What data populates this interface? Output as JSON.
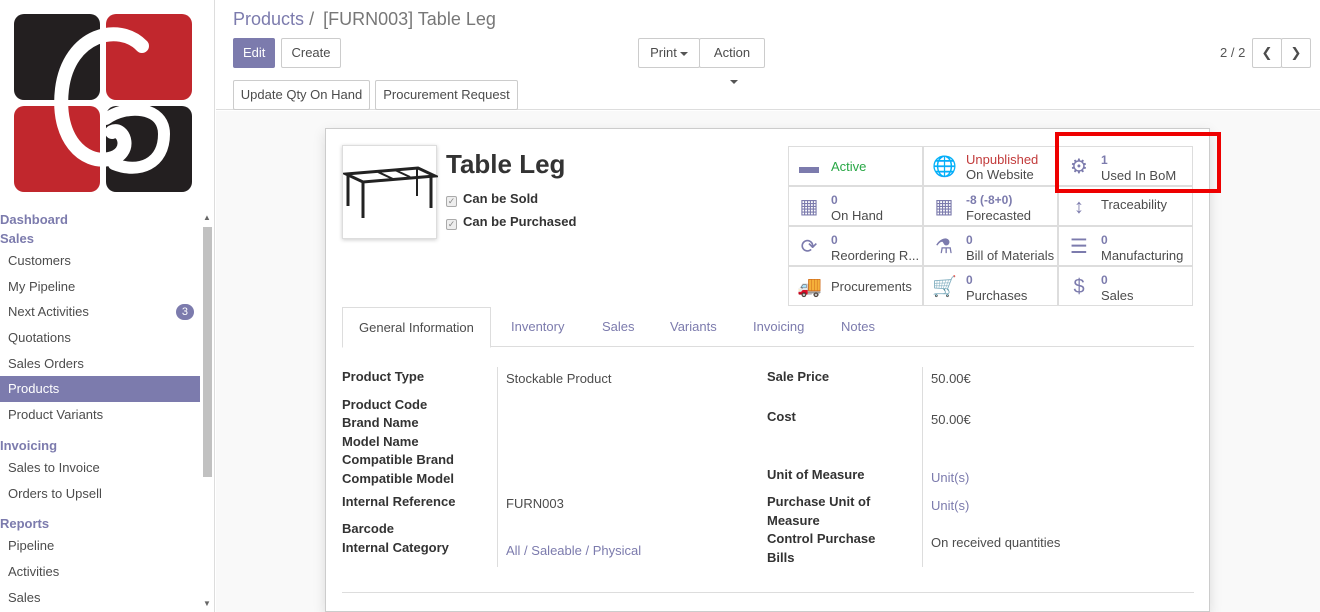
{
  "sidebar": {
    "sections": [
      {
        "title": "Dashboard"
      },
      {
        "title": "Sales",
        "items": [
          "Customers",
          "My Pipeline",
          "Next Activities",
          "Quotations",
          "Sales Orders",
          "Products",
          "Product Variants"
        ]
      },
      {
        "title": "Invoicing",
        "items": [
          "Sales to Invoice",
          "Orders to Upsell"
        ]
      },
      {
        "title": "Reports",
        "items": [
          "Pipeline",
          "Activities",
          "Sales"
        ]
      }
    ],
    "next_activities_badge": "3",
    "active_item": "Products"
  },
  "breadcrumb": {
    "parent": "Products",
    "separator": "/",
    "current": "[FURN003] Table Leg"
  },
  "buttons": {
    "edit": "Edit",
    "create": "Create",
    "print": "Print",
    "action": "Action",
    "update_qty": "Update Qty On Hand",
    "procurement_request": "Procurement Request"
  },
  "pager": {
    "value": "2 / 2"
  },
  "product": {
    "name": "Table Leg",
    "can_be_sold": "Can be Sold",
    "can_be_purchased": "Can be Purchased"
  },
  "smart_buttons": {
    "active": {
      "label": "Active",
      "color": "#28a745"
    },
    "website": {
      "line1": "Unpublished",
      "line2": "On Website",
      "color": "#c23b3b"
    },
    "bom": {
      "num": "1",
      "label": "Used In BoM"
    },
    "onhand": {
      "num": "0",
      "label": "On Hand"
    },
    "forecasted": {
      "num": "-8 (-8+0)",
      "label": "Forecasted"
    },
    "traceability": {
      "label": "Traceability"
    },
    "reordering": {
      "num": "0",
      "label": "Reordering R..."
    },
    "bom_materials": {
      "num": "0",
      "label": "Bill of Materials"
    },
    "manufacturing": {
      "num": "0",
      "label": "Manufacturing"
    },
    "procurements": {
      "label": "Procurements"
    },
    "purchases": {
      "num": "0",
      "label": "Purchases"
    },
    "sales": {
      "num": "0",
      "label": "Sales"
    }
  },
  "tabs": [
    "General Information",
    "Inventory",
    "Sales",
    "Variants",
    "Invoicing",
    "Notes"
  ],
  "fields": {
    "product_type": {
      "label": "Product Type",
      "value": "Stockable Product"
    },
    "product_code": {
      "label": "Product Code"
    },
    "brand_name": {
      "label": "Brand Name"
    },
    "model_name": {
      "label": "Model Name"
    },
    "compatible_brand": {
      "label": "Compatible Brand"
    },
    "compatible_model": {
      "label": "Compatible Model"
    },
    "internal_reference": {
      "label": "Internal Reference",
      "value": "FURN003"
    },
    "barcode": {
      "label": "Barcode"
    },
    "internal_category": {
      "label": "Internal Category",
      "value": "All / Saleable / Physical"
    },
    "sale_price": {
      "label": "Sale Price",
      "value": "50.00€"
    },
    "cost": {
      "label": "Cost",
      "value": "50.00€"
    },
    "uom": {
      "label": "Unit of Measure",
      "value": "Unit(s)"
    },
    "purchase_uom": {
      "label": "Purchase Unit of Measure",
      "value": "Unit(s)"
    },
    "control_purchase": {
      "label": "Control Purchase Bills",
      "value": "On received quantities"
    }
  },
  "colors": {
    "accent": "#7c7bad",
    "highlight": "#ee0000"
  }
}
